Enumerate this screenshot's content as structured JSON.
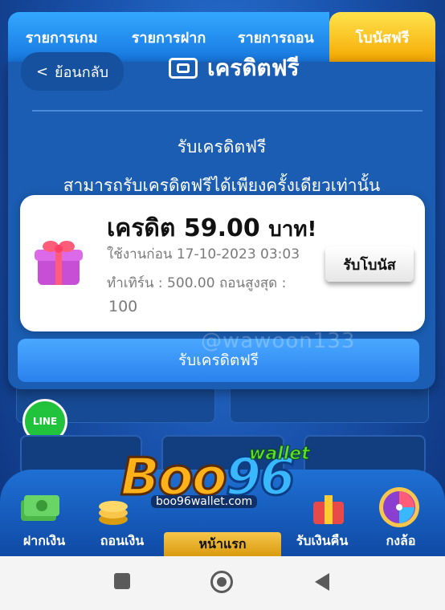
{
  "tabs": [
    "รายการเกม",
    "รายการฝาก",
    "รายการถอน",
    "โบนัสฟรี"
  ],
  "popup": {
    "back_label": "ย้อนกลับ",
    "back_chevron": "<",
    "title": "เครดิตฟรี",
    "subtitle": "รับเครดิตฟรี",
    "notice": "สามารถรับเครดิตฟรีได้เพียงครั้งเดียวเท่านั้น",
    "claim_button": "รับเครดิตฟรี"
  },
  "bonus_card": {
    "label": "เครดิต",
    "amount": "59.00",
    "unit": "บาท!",
    "expire_text": "ใช้งานก่อน 17-10-2023 03:03",
    "turnover_text": "ทำเทิร์น : 500.00 ถอนสูงสุด :",
    "max_withdraw": "100",
    "button_label": "รับโบนัส"
  },
  "watermark": "@wawoon133",
  "line_badge": "LINE",
  "logo": {
    "main": "Boo",
    "number": "96",
    "wallet": "wallet",
    "domain": "boo96wallet.com"
  },
  "bottom_nav": [
    "ฝากเงิน",
    "ถอนเงิน",
    "หน้าแรก",
    "รับเงินคืน",
    "กงล้อ"
  ],
  "colors": {
    "tab_blue": "#1777e0",
    "tab_active": "#f5a800",
    "popup_bg": "#1a5db2",
    "home_tab": "#f7c64a"
  }
}
